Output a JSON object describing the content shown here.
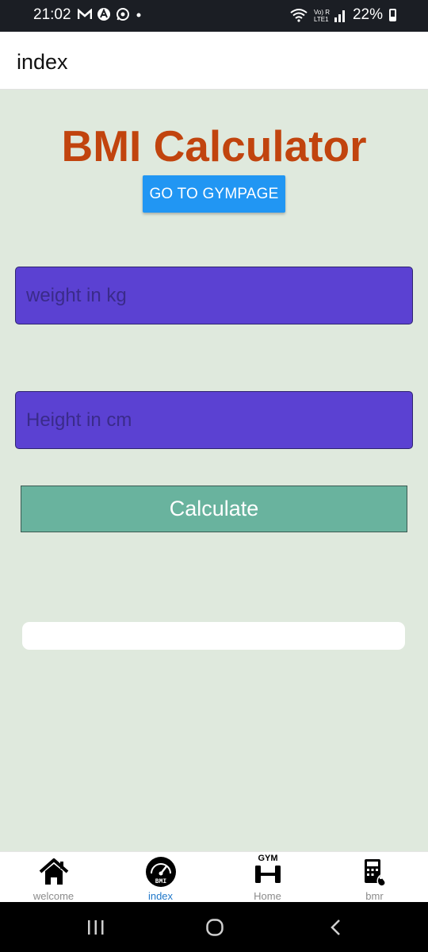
{
  "status_bar": {
    "time": "21:02",
    "network_label": "Vo) R\nLTE1",
    "battery": "22%"
  },
  "header": {
    "title": "index"
  },
  "main": {
    "title": "BMI Calculator",
    "gym_button_label": "GO TO GYMPAGE",
    "weight_placeholder": "weight in kg",
    "height_placeholder": "Height in cm",
    "calculate_label": "Calculate",
    "result": ""
  },
  "tabs": [
    {
      "label": "welcome",
      "icon": "home-icon",
      "active": false
    },
    {
      "label": "index",
      "icon": "bmi-gauge-icon",
      "active": true
    },
    {
      "label": "Home",
      "icon": "gym-dumbbell-icon",
      "active": false
    },
    {
      "label": "bmr",
      "icon": "calculator-flame-icon",
      "active": false
    }
  ],
  "colors": {
    "background": "#dfe9dd",
    "title": "#c1440e",
    "gym_button": "#2196f3",
    "input_fill": "#5b41d2",
    "calculate_button": "#69b39e",
    "active_tab": "#1f77c9"
  }
}
